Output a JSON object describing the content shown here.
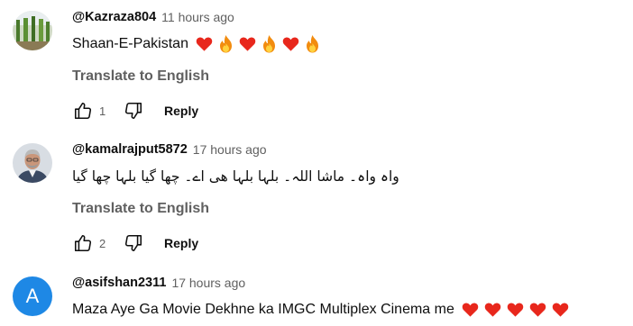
{
  "comments": [
    {
      "author": "@Kazraza804",
      "time": "11 hours ago",
      "text": "Shaan-E-Pakistan",
      "translate": "Translate to English",
      "likes": "1",
      "reply": "Reply",
      "avatar_icon": "photo-avatar-green"
    },
    {
      "author": "@kamalrajput5872",
      "time": "17 hours ago",
      "text": "واہ واہ۔ ماشا اللہ۔ بلہا بلہا ھی اے۔ چھا گیا بلہا چھا گیا",
      "translate": "Translate to English",
      "likes": "2",
      "reply": "Reply",
      "avatar_icon": "photo-avatar-man"
    },
    {
      "author": "@asifshan2311",
      "time": "17 hours ago",
      "text": "Maza Aye Ga Movie Dekhne ka IMGC Multiplex Cinema me",
      "avatar_letter": "A",
      "avatar_color": "#1e88e5"
    }
  ],
  "colors": {
    "heart": "#e8271c",
    "fire": "#f28c0f",
    "secondary_text": "#606060"
  }
}
